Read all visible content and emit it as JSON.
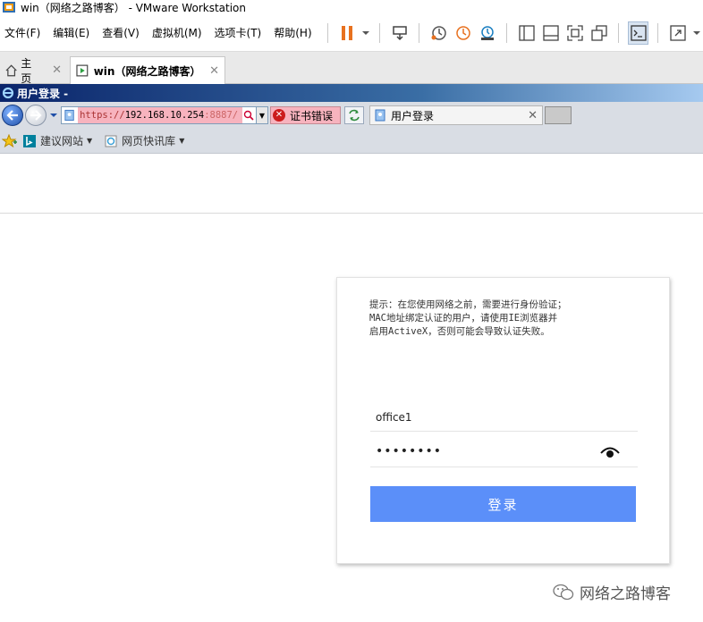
{
  "vmware": {
    "window_title": "win（网络之路博客） - VMware Workstation",
    "menu": [
      "文件(F)",
      "编辑(E)",
      "查看(V)",
      "虚拟机(M)",
      "选项卡(T)",
      "帮助(H)"
    ],
    "tabs": {
      "home": "主页",
      "win": "win（网络之路博客）"
    }
  },
  "ie": {
    "window_title": "用户登录 -",
    "address": {
      "scheme": "https://",
      "host": "192.168.10.254",
      "port": ":8887/"
    },
    "cert_error": "证书错误",
    "tab_title": "用户登录",
    "favorites": {
      "suggested_sites": "建议网站",
      "web_slice_gallery": "网页快讯库"
    }
  },
  "login": {
    "hint_lines": [
      "提示：在您使用网络之前，需要进行身份验证；",
      "MAC地址绑定认证的用户，请使用IE浏览器并",
      "启用ActiveX，否则可能会导致认证失败。"
    ],
    "username_value": "office1",
    "password_value": "••••••••",
    "submit_label": "登录"
  },
  "watermark": "网络之路博客",
  "colors": {
    "login_button": "#5b8ff9",
    "cert_error_bg": "#f7b3be",
    "pause_icon": "#e8711f"
  }
}
